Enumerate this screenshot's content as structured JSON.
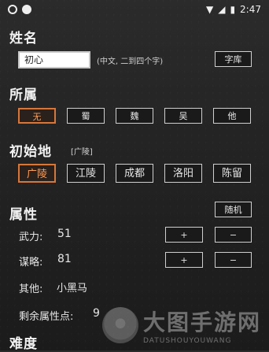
{
  "status_bar": {
    "time": "2:47"
  },
  "name": {
    "title": "姓名",
    "value": "初心",
    "hint": "(中文, 二到四个字)",
    "random_button": "字库"
  },
  "faction": {
    "title": "所属",
    "options": [
      "无",
      "蜀",
      "魏",
      "吴",
      "他"
    ],
    "selected": "无"
  },
  "origin": {
    "title": "初始地",
    "current": "[广陵]",
    "options": [
      "广陵",
      "江陵",
      "成都",
      "洛阳",
      "陈留"
    ],
    "selected": "广陵"
  },
  "attributes": {
    "title": "属性",
    "random_button": "随机",
    "stats": [
      {
        "label": "武力:",
        "value": "51"
      },
      {
        "label": "谋略:",
        "value": "81"
      }
    ],
    "plus": "+",
    "minus": "−",
    "other_label": "其他:",
    "other_value": "小黑马",
    "remaining_label": "剩余属性点:",
    "remaining_value": "9"
  },
  "difficulty": {
    "title": "难度"
  },
  "watermark": {
    "main": "大图手游网",
    "sub": "DATUSHOUYOUWANG"
  }
}
